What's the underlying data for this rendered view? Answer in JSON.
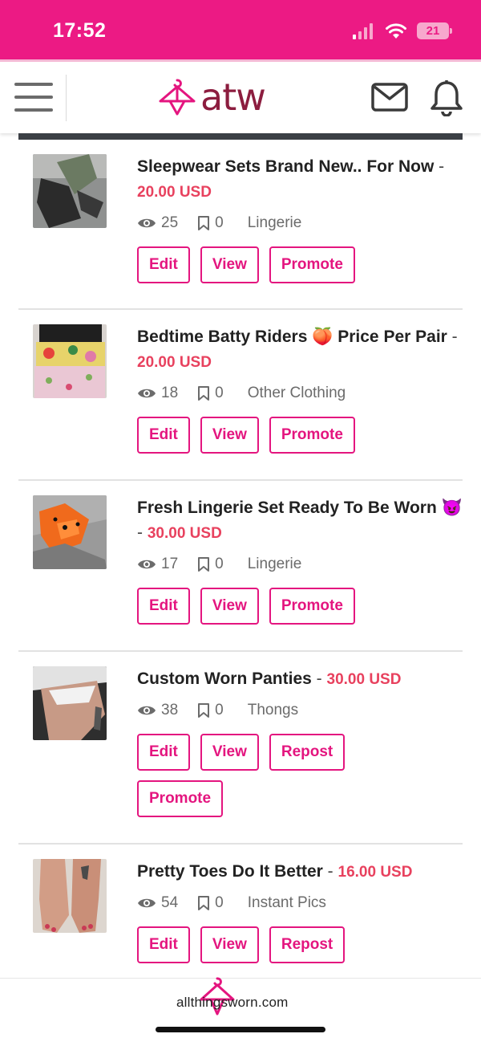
{
  "status_bar": {
    "time": "17:52",
    "battery": "21"
  },
  "header": {
    "logo_text": "atw",
    "menu_icon": "hamburger-icon",
    "mail_icon": "mail-icon",
    "bell_icon": "bell-icon"
  },
  "listings": [
    {
      "title": "Sleepwear Sets Brand New.. For Now",
      "emoji": "",
      "sep": "-",
      "price": "20.00 USD",
      "views": "25",
      "saves": "0",
      "category": "Lingerie",
      "buttons": [
        "Edit",
        "View",
        "Promote"
      ]
    },
    {
      "title": "Bedtime Batty Riders",
      "emoji": "🍑",
      "title_suffix": "Price Per Pair",
      "sep": "-",
      "price": "20.00 USD",
      "views": "18",
      "saves": "0",
      "category": "Other Clothing",
      "buttons": [
        "Edit",
        "View",
        "Promote"
      ]
    },
    {
      "title": "Fresh Lingerie Set Ready To Be Worn",
      "emoji": "😈",
      "sep": "-",
      "price": "30.00 USD",
      "views": "17",
      "saves": "0",
      "category": "Lingerie",
      "buttons": [
        "Edit",
        "View",
        "Promote"
      ]
    },
    {
      "title": "Custom Worn Panties",
      "emoji": "",
      "sep": "-",
      "price": "30.00 USD",
      "views": "38",
      "saves": "0",
      "category": "Thongs",
      "buttons": [
        "Edit",
        "View",
        "Repost",
        "Promote"
      ]
    },
    {
      "title": "Pretty Toes Do It Better",
      "emoji": "",
      "sep": "-",
      "price": "16.00 USD",
      "views": "54",
      "saves": "0",
      "category": "Instant Pics",
      "buttons": [
        "Edit",
        "View",
        "Repost"
      ]
    }
  ],
  "footer": {
    "site": "allthingsworn.com"
  },
  "colors": {
    "brand_pink": "#ec1a84",
    "price_red": "#e8415e",
    "logo_maroon": "#8c1d3f"
  }
}
